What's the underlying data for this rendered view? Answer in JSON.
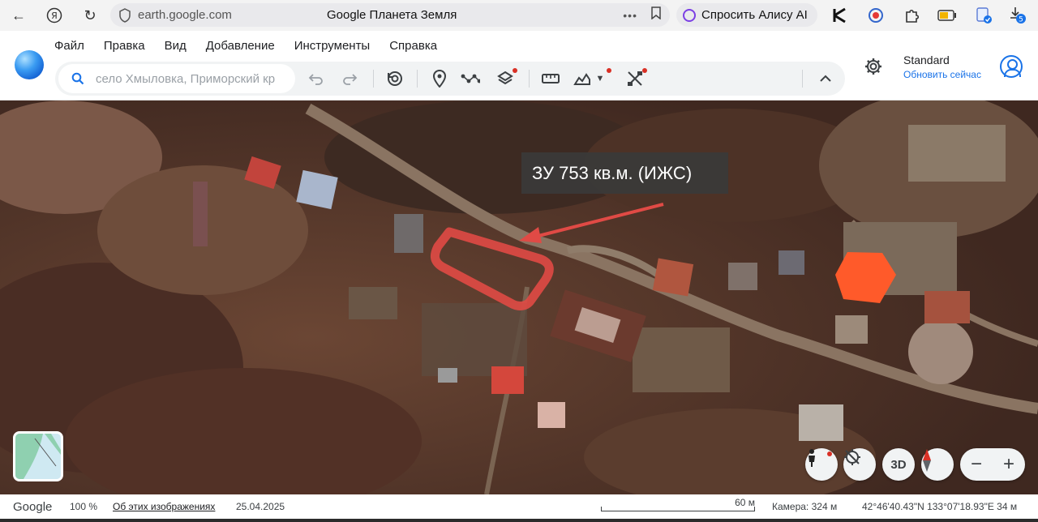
{
  "browser": {
    "url": "earth.google.com",
    "tab_title": "Google Планета Земля",
    "alice_label": "Спросить Алису AI",
    "download_badge": "5"
  },
  "menu": [
    "Файл",
    "Правка",
    "Вид",
    "Добавление",
    "Инструменты",
    "Справка"
  ],
  "search": {
    "placeholder": "село Хмыловка, Приморский кр"
  },
  "plan": {
    "name": "Standard",
    "upgrade": "Обновить сейчас"
  },
  "map": {
    "annotation": "ЗУ 753 кв.м. (ИЖС)",
    "annotation_color": "#e04a45",
    "controls": [
      "pegman-icon",
      "reset-north-icon",
      "3D",
      "compass-icon"
    ],
    "zoom_minus": "−",
    "zoom_plus": "+"
  },
  "status": {
    "brand": "Google",
    "zoom_pct": "100 %",
    "about_link": "Об этих изображениях",
    "date": "25.04.2025",
    "scale": "60 м",
    "camera": "Камера: 324 м",
    "coords": "42°46'40.43\"N 133°07'18.93\"E  34 м"
  },
  "colors": {
    "accent": "#1a73e8",
    "alert_dot": "#d93025"
  }
}
